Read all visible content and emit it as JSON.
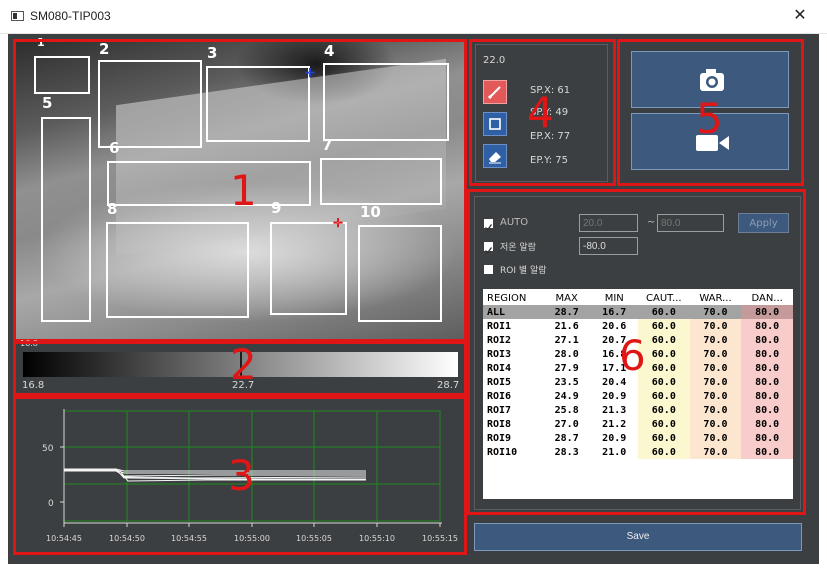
{
  "window": {
    "title": "SM080-TIP003",
    "close_glyph": "✕"
  },
  "annotations": {
    "n1": "1",
    "n2": "2",
    "n3": "3",
    "n4": "4",
    "n5": "5",
    "n6": "6"
  },
  "rois": [
    {
      "label": "1"
    },
    {
      "label": "2"
    },
    {
      "label": "3"
    },
    {
      "label": "4"
    },
    {
      "label": "5"
    },
    {
      "label": "6"
    },
    {
      "label": "7"
    },
    {
      "label": "8"
    },
    {
      "label": "9"
    },
    {
      "label": "10"
    }
  ],
  "colorbar": {
    "top_value": "16.8",
    "min": "16.8",
    "mid": "22.7",
    "max": "28.7"
  },
  "trend_chart": {
    "y_ticks": [
      "50",
      "0"
    ],
    "x_ticks": [
      "10:54:45",
      "10:54:50",
      "10:54:55",
      "10:55:00",
      "10:55:05",
      "10:55:10",
      "10:55:15"
    ]
  },
  "tools": {
    "value": "22.0",
    "sp_x": "SP.X: 61",
    "sp_y": "SP.Y: 49",
    "ep_x": "EP.X: 77",
    "ep_y": "EP.Y: 75",
    "icons": [
      "pen-icon",
      "rectangle-icon",
      "eraser-icon"
    ]
  },
  "capture": {
    "snapshot_icon": "camera-icon",
    "record_icon": "video-camera-icon"
  },
  "settings": {
    "auto_label": "AUTO",
    "auto_checked": true,
    "auto_min_placeholder": "20.0",
    "auto_tilde": "~",
    "auto_max_placeholder": "80.0",
    "apply_label": "Apply",
    "low_alarm_label": "저온 알람",
    "low_alarm_checked": true,
    "low_alarm_value": "-80.0",
    "roi_alarm_label": "ROI 별 알람",
    "roi_alarm_checked": false
  },
  "table": {
    "headers": [
      "REGION",
      "MAX",
      "MIN",
      "CAUT...",
      "WAR...",
      "DAN..."
    ],
    "rows": [
      [
        "ALL",
        "28.7",
        "16.7",
        "60.0",
        "70.0",
        "80.0"
      ],
      [
        "ROI1",
        "21.6",
        "20.6",
        "60.0",
        "70.0",
        "80.0"
      ],
      [
        "ROI2",
        "27.1",
        "20.7",
        "60.0",
        "70.0",
        "80.0"
      ],
      [
        "ROI3",
        "28.0",
        "16.8",
        "60.0",
        "70.0",
        "80.0"
      ],
      [
        "ROI4",
        "27.9",
        "17.1",
        "60.0",
        "70.0",
        "80.0"
      ],
      [
        "ROI5",
        "23.5",
        "20.4",
        "60.0",
        "70.0",
        "80.0"
      ],
      [
        "ROI6",
        "24.9",
        "20.9",
        "60.0",
        "70.0",
        "80.0"
      ],
      [
        "ROI7",
        "25.8",
        "21.3",
        "60.0",
        "70.0",
        "80.0"
      ],
      [
        "ROI8",
        "27.0",
        "21.2",
        "60.0",
        "70.0",
        "80.0"
      ],
      [
        "ROI9",
        "28.7",
        "20.9",
        "60.0",
        "70.0",
        "80.0"
      ],
      [
        "ROI10",
        "28.3",
        "21.0",
        "60.0",
        "70.0",
        "80.0"
      ]
    ]
  },
  "save": {
    "label": "Save"
  },
  "colors": {
    "annotation_red": "#e01616",
    "button_blue": "#3d5a7e",
    "caution_yellow": "#fbf7cf",
    "warning_orange": "#fde6cf",
    "danger_pink": "#f9cccc",
    "selected_row": "#a3a3a3",
    "panel_bg": "#3c3f41"
  }
}
